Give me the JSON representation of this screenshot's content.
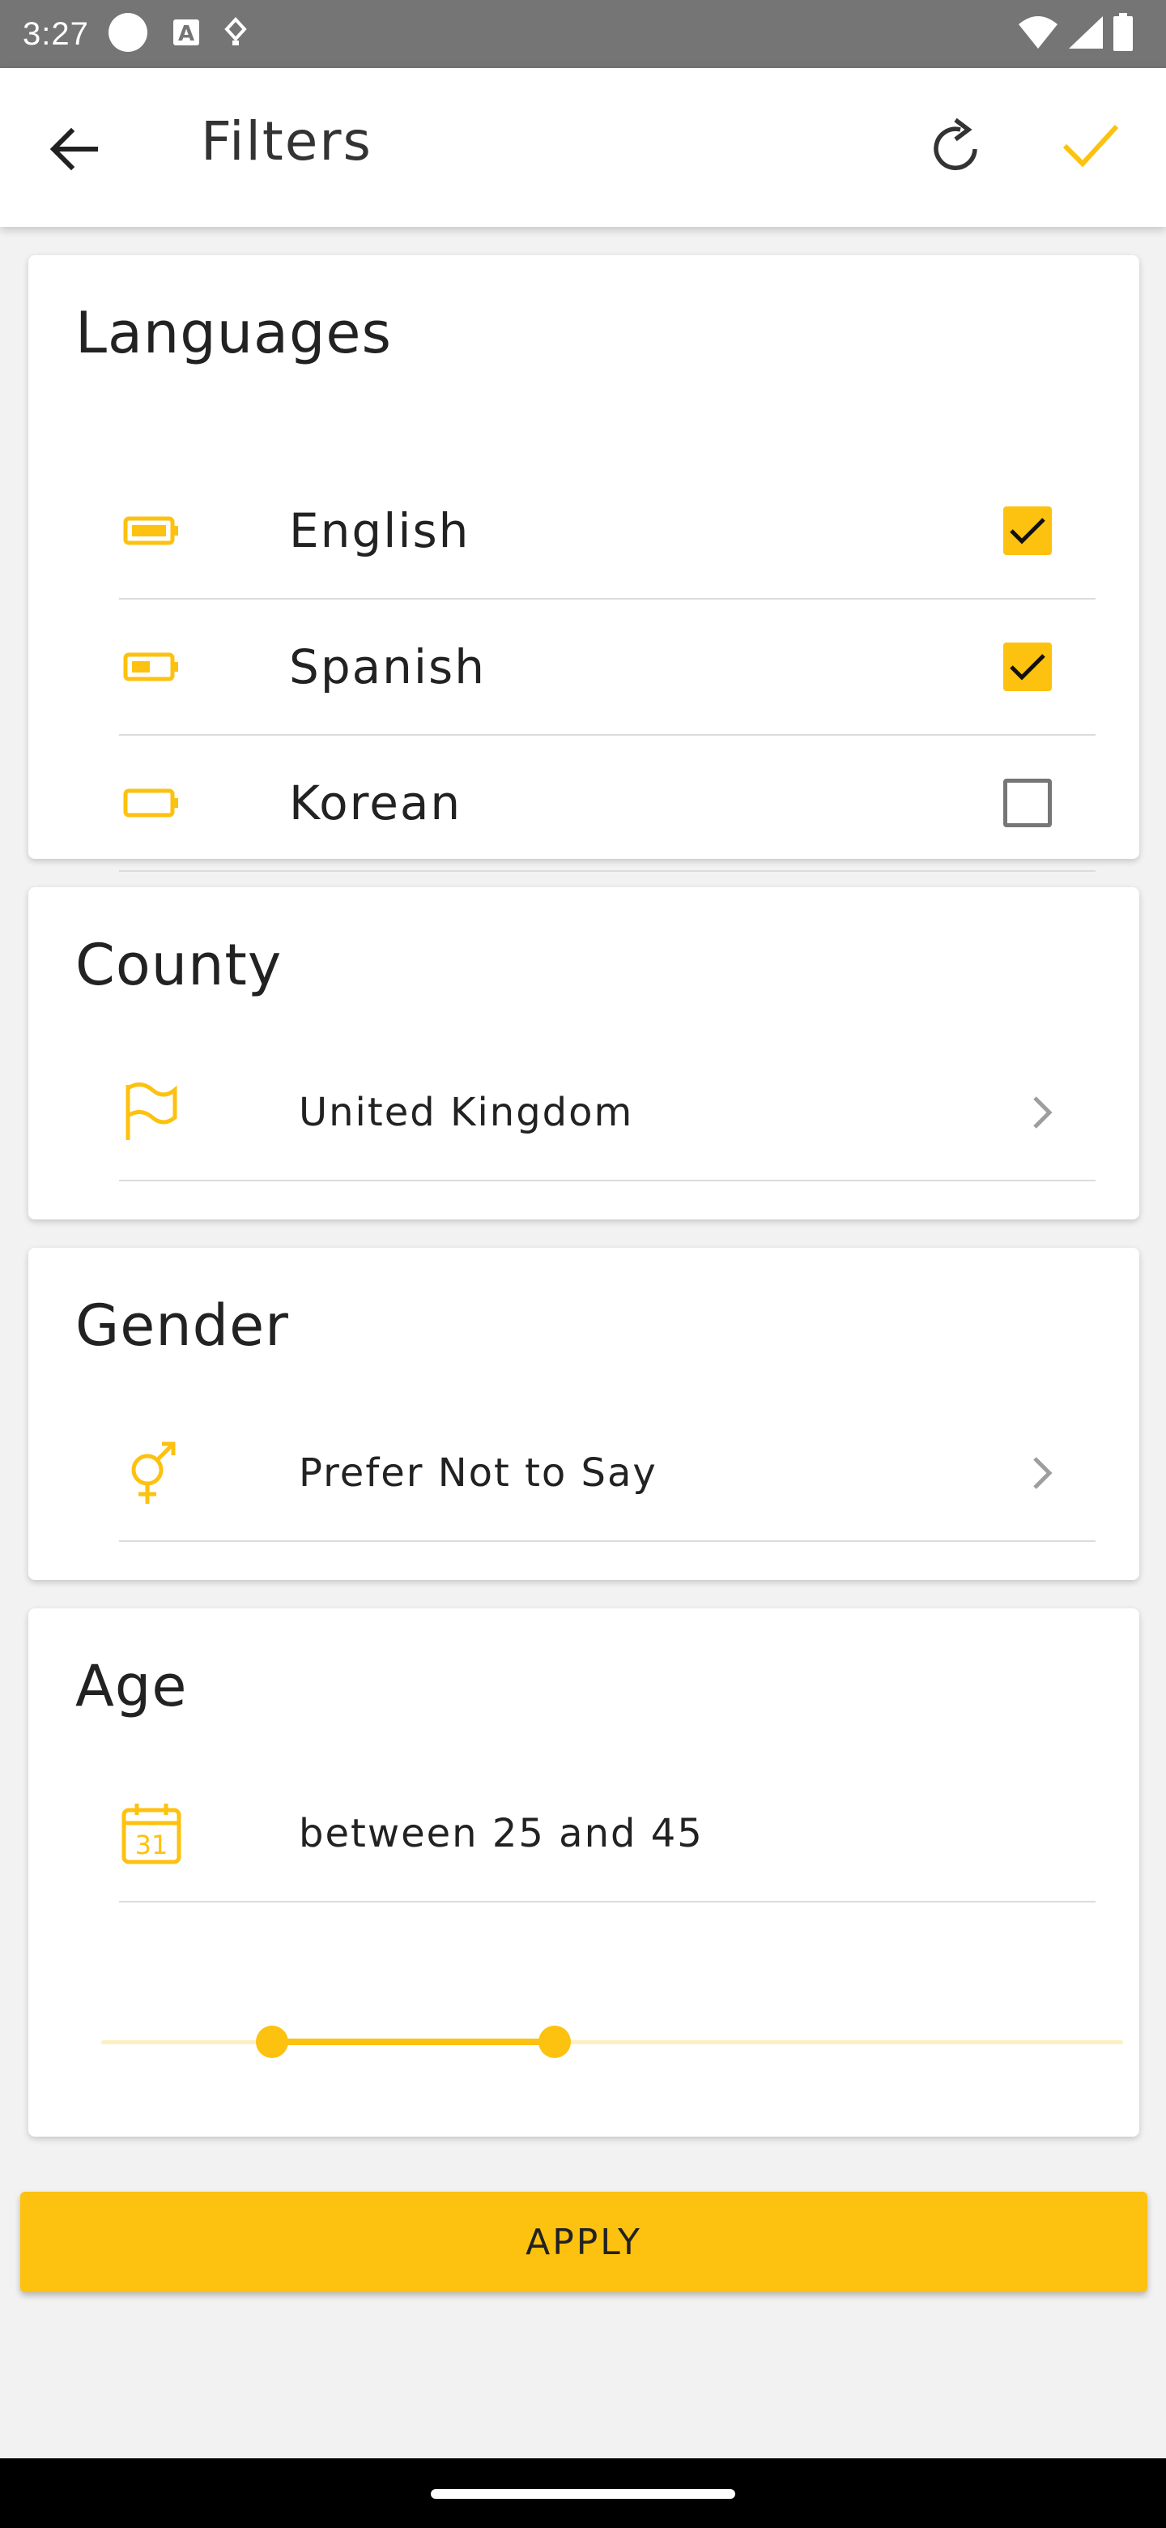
{
  "status_bar": {
    "time": "3:27",
    "icons": [
      "circle-icon",
      "font-a-icon",
      "debug-icon",
      "wifi-icon",
      "signal-icon",
      "battery-icon"
    ]
  },
  "app_bar": {
    "title": "Filters",
    "icons": {
      "back": "arrow-back-icon",
      "refresh": "refresh-icon",
      "confirm": "check-icon"
    }
  },
  "colors": {
    "accent": "#FDC10F",
    "accent_light": "#FCEFC2",
    "text": "#212121",
    "divider": "#DCDCDC"
  },
  "languages": {
    "title": "Languages",
    "items": [
      {
        "label": "English",
        "checked": true,
        "icon": "battery-full-icon"
      },
      {
        "label": "Spanish",
        "checked": true,
        "icon": "battery-half-icon"
      },
      {
        "label": "Korean",
        "checked": false,
        "icon": "battery-empty-icon"
      }
    ]
  },
  "county": {
    "title": "County",
    "value": "United Kingdom",
    "icon": "flag-icon"
  },
  "gender": {
    "title": "Gender",
    "value": "Prefer Not to Say",
    "icon": "gender-icon"
  },
  "age": {
    "title": "Age",
    "value": "between 25 and 45",
    "icon": "calendar-icon",
    "calendar_day": "31",
    "range": {
      "low_fraction": 0.167,
      "high_fraction": 0.444
    }
  },
  "apply_button": {
    "label": "APPLY"
  }
}
